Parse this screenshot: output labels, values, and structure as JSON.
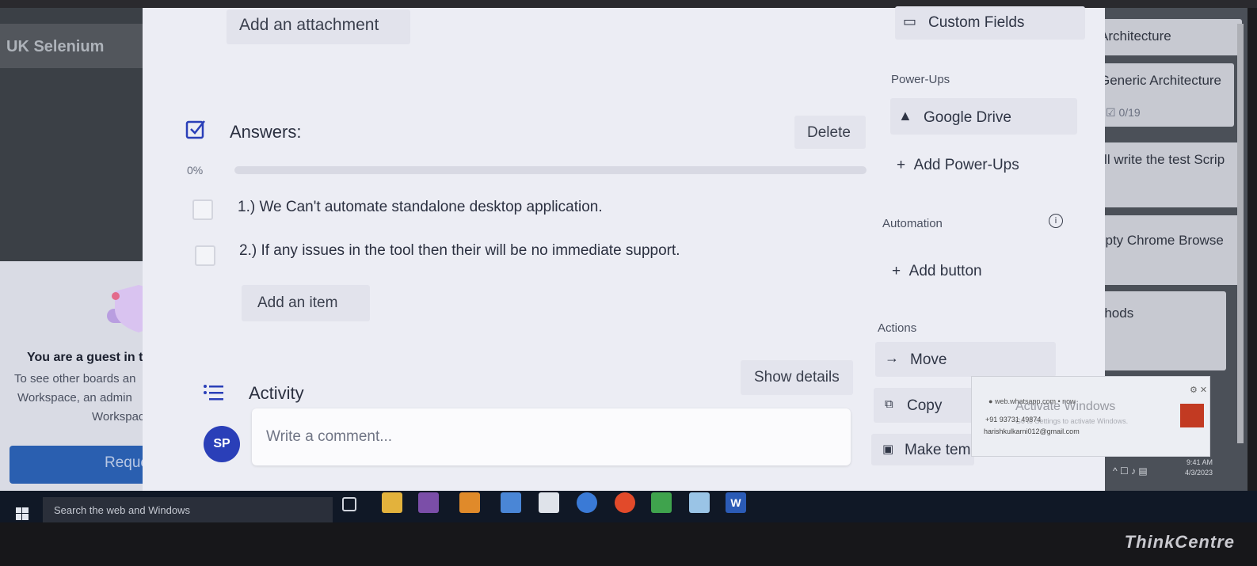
{
  "board": {
    "left_title": "UK Selenium",
    "guest": {
      "title": "You are a guest in t",
      "line1": "To see other boards an",
      "line2": "Workspace, an admin",
      "line3": "Workspace n",
      "request_button": "Request t"
    },
    "right_cards": [
      "Architecture",
      "Generic Architecture",
      "0/19",
      "will write the test Scrip",
      "Empty Chrome Browse",
      "Methods"
    ]
  },
  "card": {
    "attachment_button": "Add an attachment",
    "checklist": {
      "title": "Answers:",
      "delete_button": "Delete",
      "progress_label": "0%",
      "progress_value": 0,
      "items": [
        {
          "text": "1.) We Can't automate standalone desktop application.",
          "checked": false
        },
        {
          "text": "2.) If any issues in the tool then their will be no immediate support.",
          "checked": false
        }
      ],
      "add_item_button": "Add an item"
    },
    "activity": {
      "title": "Activity",
      "show_details_button": "Show details",
      "avatar_initials": "SP",
      "comment_placeholder": "Write a comment..."
    }
  },
  "sidebar": {
    "custom_fields": "Custom Fields",
    "power_ups_heading": "Power-Ups",
    "google_drive": "Google Drive",
    "add_power_ups": "Add Power-Ups",
    "automation_heading": "Automation",
    "add_button": "Add button",
    "actions_heading": "Actions",
    "move": "Move",
    "copy": "Copy",
    "make_template": "Make tem"
  },
  "notification": {
    "source": "web.whatsapp.com • now",
    "phone": "+91 93731 49874",
    "email": "harishkulkarni012@gmail.com",
    "activate_title": "Activate Windows",
    "activate_sub": "Go to Settings to activate Windows."
  },
  "taskbar": {
    "search_text": "Search the web and Windows",
    "time": "9:41 AM",
    "date": "4/3/2023"
  },
  "monitor": {
    "brand": "ThinkCentre"
  },
  "colors": {
    "accent_blue": "#2a3fb8",
    "progress_green": "#5aac44",
    "request_blue": "#2a5fb0"
  }
}
